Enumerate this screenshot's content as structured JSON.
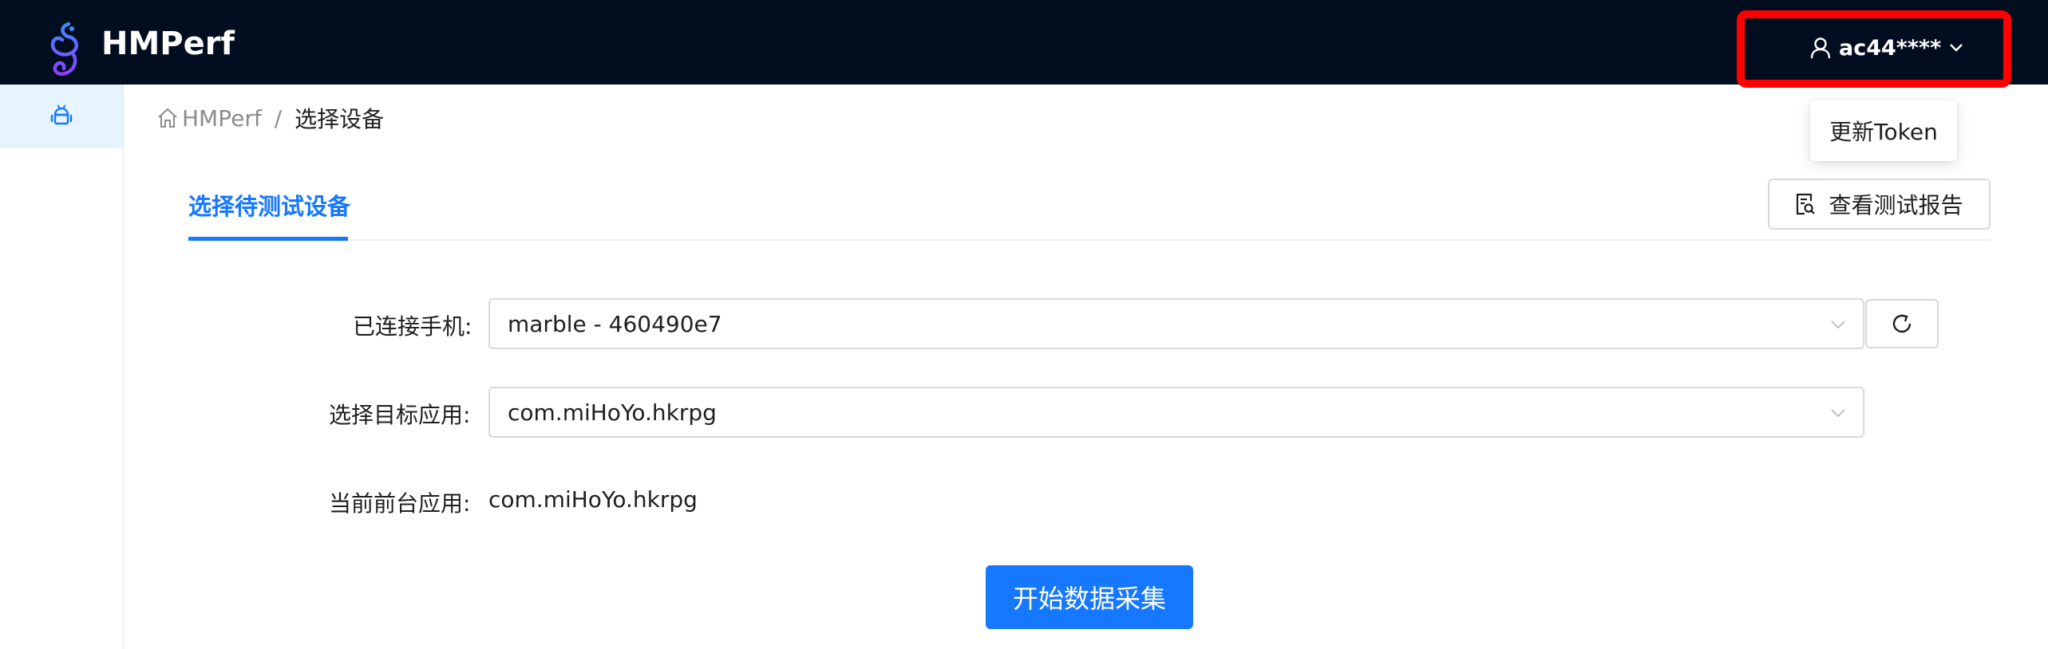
{
  "header": {
    "brand": "HMPerf",
    "user": "ac44****",
    "logo_icon": "seahorse-logo",
    "highlight_color": "#ff0000"
  },
  "sidebar": {
    "items": [
      {
        "icon": "android-icon",
        "active": true
      }
    ]
  },
  "breadcrumb": {
    "home_icon": "home-icon",
    "items": [
      "HMPerf",
      "选择设备"
    ],
    "separator": "/"
  },
  "user_dropdown": {
    "items": [
      "更新Token"
    ]
  },
  "tabs": {
    "active": "选择待测试设备",
    "accent": "#1677ff"
  },
  "report_button": {
    "label": "查看测试报告",
    "icon": "file-search-icon"
  },
  "form": {
    "phone_label": "已连接手机:",
    "phone_value": "marble - 460490e7",
    "app_label": "选择目标应用:",
    "app_value": "com.miHoYo.hkrpg",
    "foreground_label": "当前前台应用:",
    "foreground_value": "com.miHoYo.hkrpg"
  },
  "start_button": {
    "label": "开始数据采集"
  }
}
